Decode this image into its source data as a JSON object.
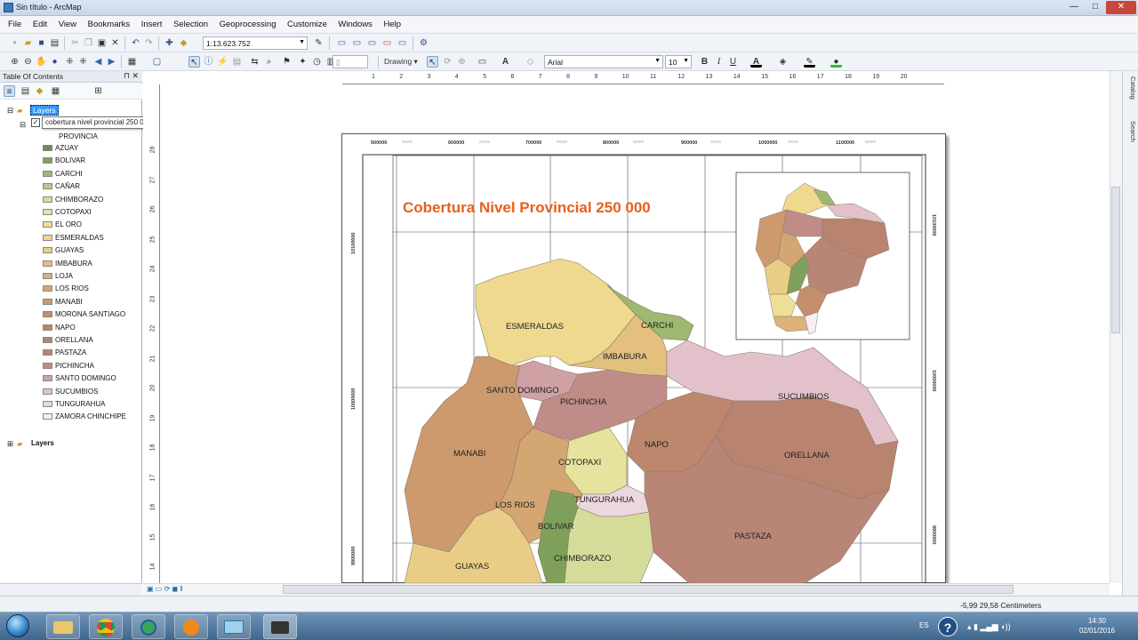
{
  "window": {
    "title": "Sin título - ArcMap",
    "min": "—",
    "max": "□",
    "close": "✕"
  },
  "menu": [
    "File",
    "Edit",
    "View",
    "Bookmarks",
    "Insert",
    "Selection",
    "Geoprocessing",
    "Customize",
    "Windows",
    "Help"
  ],
  "toolbar": {
    "scale_value": "1:13.623.752",
    "drawing_label": "Drawing",
    "font_name": "Arial",
    "font_size": "10",
    "bold": "B",
    "italic": "I",
    "underline": "U",
    "font_color_label": "A"
  },
  "toc": {
    "title": "Table Of Contents",
    "pin": "⊓",
    "close": "✕",
    "dataframe_name": "Layers",
    "layer_name": "cobertura nivel provincial 250 000",
    "field_heading": "PROVINCIA",
    "second_dataframe": "Layers",
    "legend": [
      {
        "label": "AZUAY",
        "color": "#6e8f48"
      },
      {
        "label": "BOLIVAR",
        "color": "#7fa05a"
      },
      {
        "label": "CARCHI",
        "color": "#9db870"
      },
      {
        "label": "CAÑAR",
        "color": "#b7c98c"
      },
      {
        "label": "CHIMBORAZO",
        "color": "#d5dc9a"
      },
      {
        "label": "COTOPAXI",
        "color": "#e6e39e"
      },
      {
        "label": "EL ORO",
        "color": "#eedf97"
      },
      {
        "label": "ESMERALDAS",
        "color": "#eed98f"
      },
      {
        "label": "GUAYAS",
        "color": "#e9cd86"
      },
      {
        "label": "IMBABURA",
        "color": "#e3c07e"
      },
      {
        "label": "LOJA",
        "color": "#dcb277"
      },
      {
        "label": "LOS RIOS",
        "color": "#d4a672"
      },
      {
        "label": "MANABI",
        "color": "#cc9a6d"
      },
      {
        "label": "MORONA SANTIAGO",
        "color": "#c38f6c"
      },
      {
        "label": "NAPO",
        "color": "#bc876c"
      },
      {
        "label": "ORELLANA",
        "color": "#b8846f"
      },
      {
        "label": "PASTAZA",
        "color": "#b98577"
      },
      {
        "label": "PICHINCHA",
        "color": "#c08c88"
      },
      {
        "label": "SANTO  DOMINGO",
        "color": "#cfa0a4"
      },
      {
        "label": "SUCUMBIOS",
        "color": "#e2c1cb"
      },
      {
        "label": "TUNGURAHUA",
        "color": "#ecd6df"
      },
      {
        "label": "ZAMORA CHINCHIPE",
        "color": "#f6eef2"
      }
    ]
  },
  "layout": {
    "map_title": "Cobertura Nivel Provincial 250 000",
    "title_color": "#e8601c",
    "top_ticks": [
      "500000",
      "600000",
      "700000",
      "800000",
      "900000",
      "1000000",
      "1100000"
    ],
    "side_ticks": [
      "10100000",
      "10000000",
      "9900000"
    ],
    "hruler_labels": [
      "1",
      "2",
      "3",
      "4",
      "5",
      "6",
      "7",
      "8",
      "9",
      "10",
      "11",
      "12",
      "13",
      "14",
      "15",
      "16",
      "17",
      "18",
      "19",
      "20"
    ],
    "vruler_labels": [
      "28",
      "27",
      "26",
      "25",
      "24",
      "23",
      "22",
      "21",
      "20",
      "19",
      "18",
      "17",
      "16",
      "15",
      "14"
    ],
    "province_labels": [
      "ESMERALDAS",
      "CARCHI",
      "IMBABURA",
      "SANTO  DOMINGO",
      "PICHINCHA",
      "SUCUMBIOS",
      "MANABI",
      "NAPO",
      "ORELLANA",
      "COTOPAXI",
      "LOS RIOS",
      "TUNGURAHUA",
      "BOLIVAR",
      "PASTAZA",
      "GUAYAS",
      "CHIMBORAZO"
    ]
  },
  "right_dock": [
    "Catalog",
    "Search"
  ],
  "status": {
    "coordinates": "-5,99  29,58 Centimeters"
  },
  "taskbar": {
    "language": "ES",
    "time": "14:30",
    "date": "02/01/2016"
  }
}
